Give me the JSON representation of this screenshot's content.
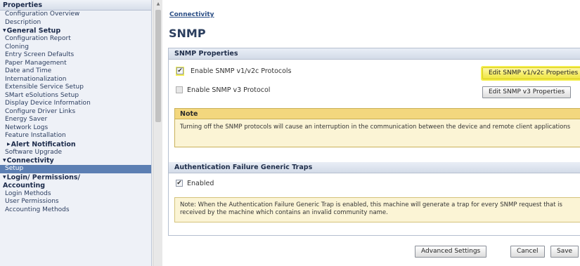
{
  "sidebar": {
    "header": "Properties",
    "items_top": [
      "Configuration Overview",
      "Description"
    ],
    "general_setup": {
      "title": "General Setup",
      "items": [
        "Configuration Report",
        "Cloning",
        "Entry Screen Defaults",
        "Paper Management",
        "Date and Time",
        "Internationalization",
        "Extensible Service Setup",
        "SMart eSolutions Setup",
        "Display Device Information",
        "Configure Driver Links",
        "Energy Saver",
        "Network Logs",
        "Feature Installation"
      ],
      "alert_notification": "Alert Notification",
      "software_upgrade": "Software Upgrade"
    },
    "connectivity": {
      "title": "Connectivity",
      "items": [
        "Setup"
      ]
    },
    "login": {
      "title_line1": "Login/ Permissions/",
      "title_line2": "Accounting",
      "items": [
        "Login Methods",
        "User Permissions",
        "Accounting Methods"
      ]
    }
  },
  "main": {
    "breadcrumb": "Connectivity",
    "title": "SNMP",
    "snmp_properties": {
      "header": "SNMP Properties",
      "v1v2c_label": "Enable SNMP v1/v2c Protocols",
      "v1v2c_checked": true,
      "v3_label": "Enable SNMP v3 Protocol",
      "v3_checked": false,
      "edit_v1v2c_button": "Edit SNMP v1/v2c Properties",
      "edit_v3_button": "Edit SNMP v3 Properties"
    },
    "note": {
      "header": "Note",
      "text": "Turning off the SNMP protocols will cause an interruption in the communication between the device and remote client applications"
    },
    "auth_traps": {
      "header": "Authentication Failure Generic Traps",
      "enabled_label": "Enabled",
      "enabled_checked": true,
      "note_text": "Note: When the Authentication Failure Generic Trap is enabled, this machine will generate a trap for every SNMP request that is received by the machine which contains an invalid community name."
    },
    "buttons": {
      "advanced": "Advanced Settings",
      "cancel": "Cancel",
      "save": "Save"
    }
  },
  "colors": {
    "highlight": "#f4ee4c",
    "active_nav": "#5c7fb3",
    "note_header": "#f3d77e"
  }
}
